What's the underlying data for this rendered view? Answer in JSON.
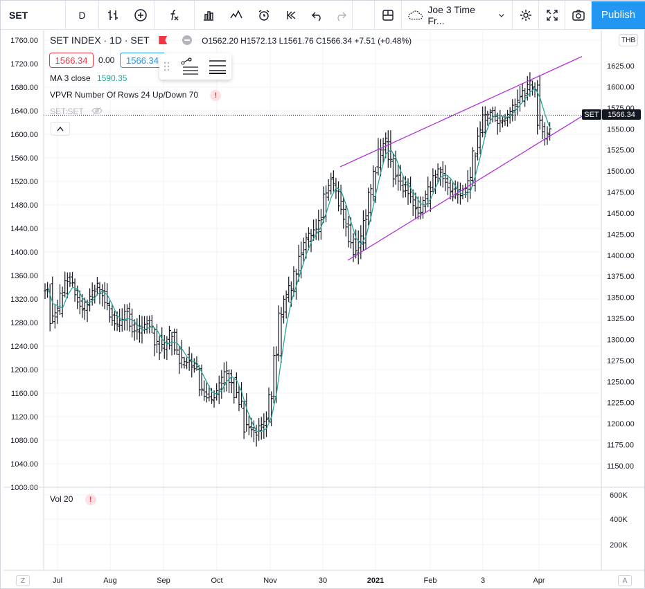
{
  "toolbar": {
    "symbol": "SET",
    "interval": "D",
    "template": "Joe 3 Time Fr...",
    "publish": "Publish"
  },
  "legend": {
    "title": "SET INDEX · 1D · SET",
    "ohlc": {
      "o_label": "O",
      "o": "1562.20",
      "h_label": "H",
      "h": "1572.13",
      "l_label": "L",
      "l": "1561.76",
      "c_label": "C",
      "c": "1566.34",
      "chg": "+7.51 (+0.48%)"
    },
    "bid": "1566.34",
    "spread": "0.00",
    "ask": "1566.34",
    "ma": {
      "label": "MA 3 close",
      "value": "1590.35"
    },
    "vpvr": "VPVR Number Of Rows 24 Up/Down 70",
    "compare": "SET:SET",
    "vol": "Vol 20"
  },
  "right_scale_tags": {
    "currency": "THB",
    "last_symbol": "SET",
    "last_value": "1566.34"
  },
  "bottom_bar": {
    "left": "Z",
    "right": "A"
  },
  "colors": {
    "ma": "#26a69a",
    "channel": "#b431d9",
    "bars": "#131722",
    "publish": "#2196f3",
    "red": "#f23645",
    "blue": "#2196f3"
  },
  "chart_data": {
    "type": "ohlc",
    "title": "SET INDEX · 1D · SET",
    "left_axis": {
      "ticks": [
        1760,
        1720,
        1680,
        1640,
        1600,
        1560,
        1520,
        1480,
        1440,
        1400,
        1360,
        1320,
        1280,
        1240,
        1200,
        1160,
        1120,
        1080,
        1040,
        1000
      ],
      "labels": [
        "1760.00",
        "1720.00",
        "1680.00",
        "1640.00",
        "1600.00",
        "1560.00",
        "1520.00",
        "1480.00",
        "1440.00",
        "1400.00",
        "1360.00",
        "1320.00",
        "1280.00",
        "1240.00",
        "1200.00",
        "1160.00",
        "1120.00",
        "1080.00",
        "1040.00",
        "1000.00"
      ]
    },
    "right_axis": {
      "ticks": [
        1625,
        1600,
        1575,
        1550,
        1525,
        1500,
        1475,
        1450,
        1425,
        1400,
        1375,
        1350,
        1325,
        1300,
        1275,
        1250,
        1225,
        1200,
        1175,
        1150
      ],
      "labels": [
        "1625.00",
        "1600.00",
        "1575.00",
        "1550.00",
        "1525.00",
        "1500.00",
        "1475.00",
        "1450.00",
        "1425.00",
        "1400.00",
        "1375.00",
        "1350.00",
        "1325.00",
        "1300.00",
        "1275.00",
        "1250.00",
        "1225.00",
        "1200.00",
        "1175.00",
        "1150.00"
      ]
    },
    "volume_axis": {
      "labels": [
        "600K",
        "400K",
        "200K"
      ]
    },
    "x_labels": [
      "Jul",
      "Aug",
      "Sep",
      "Oct",
      "Nov",
      "30",
      "2021",
      "Feb",
      "3",
      "Apr"
    ],
    "last_price": 1566.34,
    "ma_period": 3,
    "prices": [
      1340,
      1285,
      1300,
      1330,
      1350,
      1340,
      1320,
      1305,
      1315,
      1330,
      1340,
      1330,
      1310,
      1290,
      1275,
      1285,
      1300,
      1270,
      1260,
      1270,
      1280,
      1270,
      1250,
      1235,
      1245,
      1260,
      1230,
      1215,
      1220,
      1210,
      1205,
      1170,
      1160,
      1155,
      1160,
      1180,
      1200,
      1185,
      1160,
      1140,
      1100,
      1095,
      1090,
      1100,
      1110,
      1150,
      1220,
      1290,
      1320,
      1340,
      1370,
      1400,
      1420,
      1430,
      1440,
      1460,
      1500,
      1520,
      1510,
      1480,
      1450,
      1420,
      1400,
      1420,
      1460,
      1500,
      1540,
      1570,
      1590,
      1560,
      1530,
      1520,
      1510,
      1495,
      1480,
      1470,
      1490,
      1510,
      1530,
      1540,
      1525,
      1510,
      1500,
      1490,
      1500,
      1520,
      1570,
      1600,
      1630,
      1640,
      1630,
      1625,
      1630,
      1640,
      1650,
      1660,
      1670,
      1685,
      1680,
      1620,
      1600,
      1610
    ],
    "channel": {
      "upper": [
        [
          1473,
          1505
        ],
        [
          1620,
          1636
        ]
      ],
      "lower": [
        [
          1451,
          1394
        ],
        [
          1639,
          1569
        ]
      ]
    }
  }
}
